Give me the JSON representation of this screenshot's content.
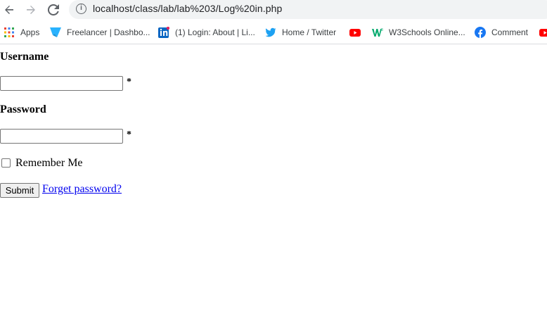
{
  "browser": {
    "url": "localhost/class/lab/lab%203/Log%20in.php",
    "bookmarks": [
      {
        "label": "Apps",
        "icon": "apps-grid-icon"
      },
      {
        "label": "Freelancer | Dashbo...",
        "icon": "freelancer-icon"
      },
      {
        "label": "(1) Login: About | Li...",
        "icon": "linkedin-icon"
      },
      {
        "label": "Home / Twitter",
        "icon": "twitter-icon"
      },
      {
        "label": "",
        "icon": "youtube-icon"
      },
      {
        "label": "W3Schools Online...",
        "icon": "w3schools-icon"
      },
      {
        "label": "Comment",
        "icon": "facebook-icon"
      },
      {
        "label": "",
        "icon": "youtube-icon"
      }
    ]
  },
  "form": {
    "username_label": "Username",
    "username_required": "*",
    "password_label": "Password",
    "password_required": "*",
    "remember_label": "Remember Me",
    "submit_label": "Submit",
    "forgot_label": "Forget password?"
  },
  "colors": {
    "link": "#0000ee",
    "twitter": "#1da1f2",
    "youtube": "#ff0000",
    "facebook": "#1877f2",
    "linkedin": "#0a66c2",
    "w3schools": "#04aa6d"
  }
}
